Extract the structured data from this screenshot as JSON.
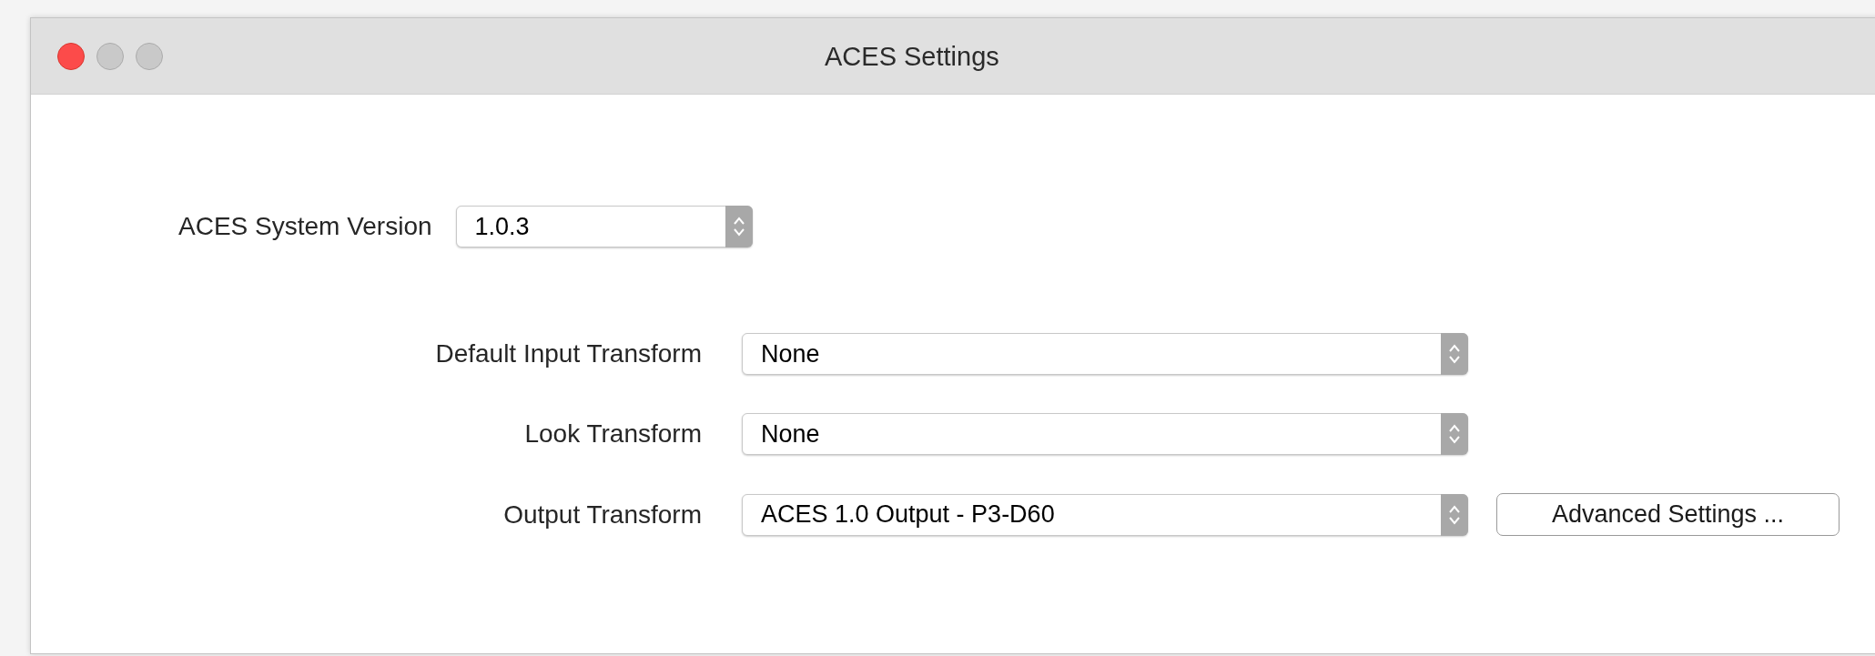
{
  "window": {
    "title": "ACES Settings",
    "buttons": [
      {
        "kind": "close"
      },
      {
        "kind": "minimize"
      },
      {
        "kind": "zoom"
      }
    ]
  },
  "system_version": {
    "label": "ACES System Version",
    "value": "1.0.3"
  },
  "transforms": [
    {
      "label": "Default Input Transform",
      "value": "None"
    },
    {
      "label": "Look Transform",
      "value": "None"
    },
    {
      "label": "Output Transform",
      "value": "ACES 1.0 Output - P3-D60",
      "button": "Advanced Settings ..."
    }
  ]
}
